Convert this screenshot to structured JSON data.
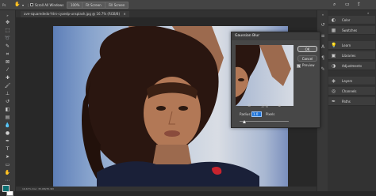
{
  "optionsbar": {
    "scroll_all_windows": "Scroll All Windows",
    "zoom_level": "100%",
    "fit_screen": "Fit Screen",
    "fill_screen": "Fill Screen"
  },
  "document": {
    "tab_title": "ave-squarededo-Ydrs-cyaedp-unsplash.jpg @ 16.7% (RGB/8)",
    "status_text": "16.67%      Doc: 35.9M/35.9M"
  },
  "panels": [
    {
      "icon": "color-icon",
      "label": "Color"
    },
    {
      "icon": "swatches-icon",
      "label": "Swatches"
    },
    {
      "icon": "learn-icon",
      "label": "Learn"
    },
    {
      "icon": "libraries-icon",
      "label": "Libraries"
    },
    {
      "icon": "adjustments-icon",
      "label": "Adjustments"
    },
    {
      "icon": "layers-icon",
      "label": "Layers"
    },
    {
      "icon": "channels-icon",
      "label": "Channels"
    },
    {
      "icon": "paths-icon",
      "label": "Paths"
    }
  ],
  "dialog": {
    "title": "Gaussian Blur",
    "ok_label": "OK",
    "cancel_label": "Cancel",
    "preview_label": "Preview",
    "preview_checked": true,
    "zoom_text": "17%",
    "radius_label": "Radius:",
    "radius_value": "1.0",
    "radius_unit": "Pixels"
  },
  "colors": {
    "foreground": "#0b6f72",
    "background": "#ffffff",
    "accent": "#1e74d8"
  }
}
